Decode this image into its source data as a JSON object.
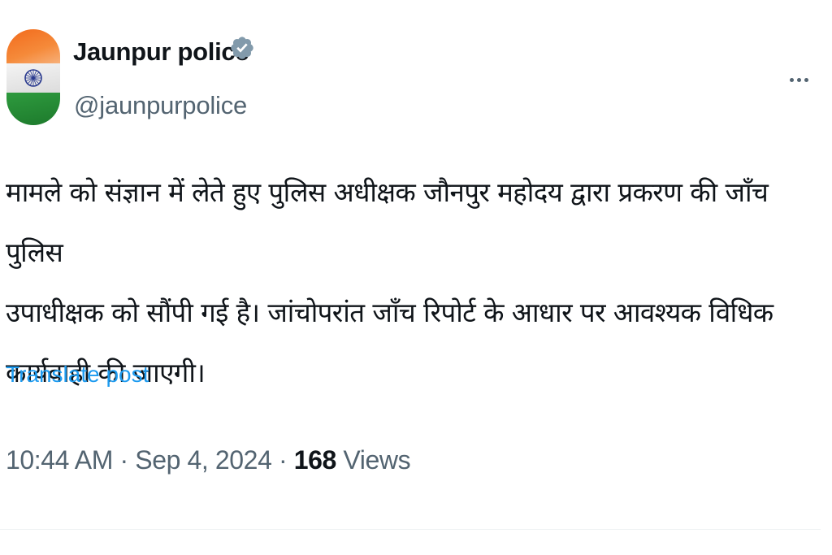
{
  "author": {
    "display_name": "Jaunpur police",
    "handle": "@jaunpurpolice",
    "verified": true,
    "avatar_icon": "indian-flag-avatar"
  },
  "post": {
    "lines": [
      "मामले को संज्ञान में लेते हुए पुलिस अधीक्षक जौनपुर महोदय द्वारा प्रकरण की जाँच पुलिस",
      "उपाधीक्षक को सौंपी गई है। जांचोपरांत जाँच रिपोर्ट के आधार पर आवश्यक विधिक",
      "कार्यवाही की जाएगी।"
    ],
    "translate_label": "Translate post"
  },
  "meta": {
    "time": "10:44 AM",
    "separator": " · ",
    "date": "Sep 4, 2024",
    "views_count": "168",
    "views_label": " Views"
  },
  "colors": {
    "link": "#1d9bf0",
    "secondary_text": "#536471",
    "primary_text": "#0f1419"
  }
}
